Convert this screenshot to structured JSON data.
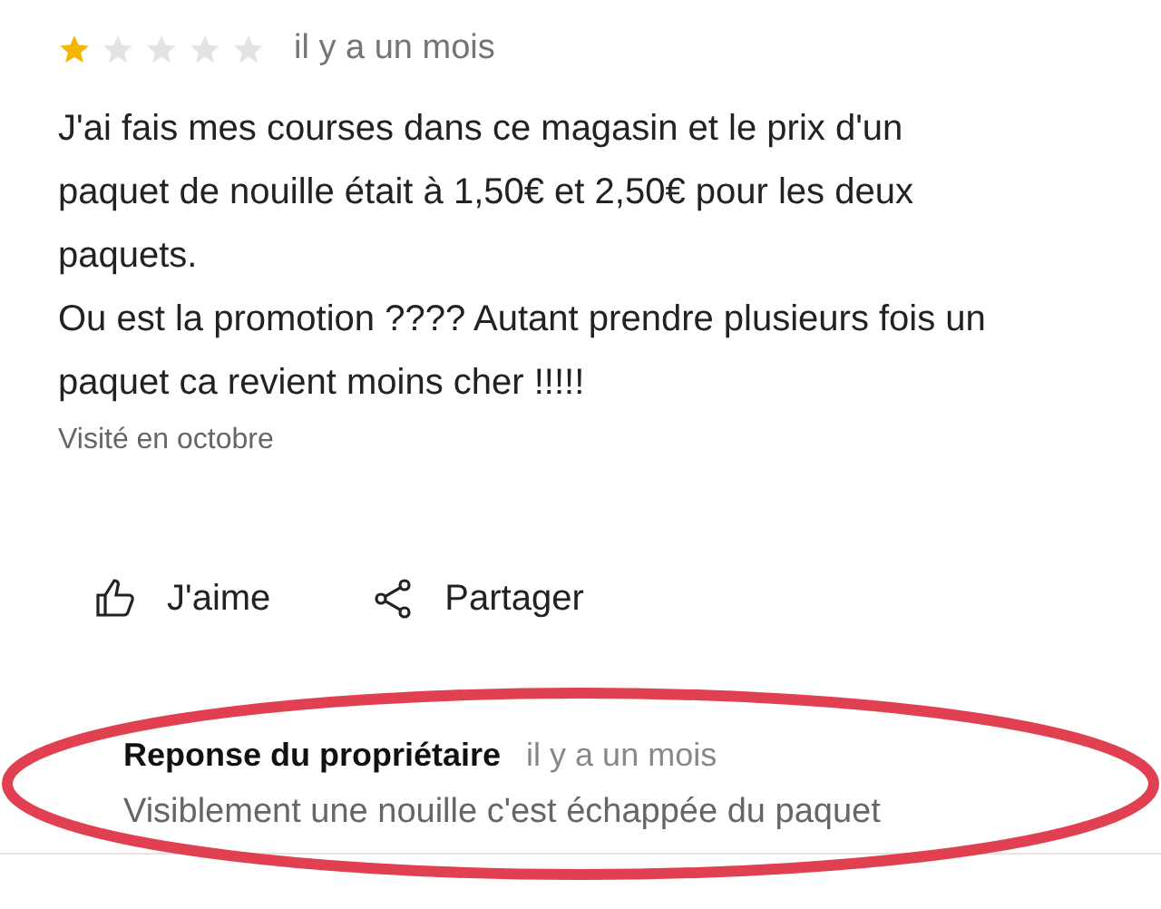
{
  "review": {
    "stars": 1,
    "time": "il y a un mois",
    "paragraphs": [
      "J'ai fais mes courses dans ce magasin et le prix d'un paquet de nouille était à 1,50€ et 2,50€ pour les deux paquets.",
      "Ou est la promotion ???? Autant prendre plusieurs fois un paquet ca revient moins cher !!!!!"
    ],
    "visited": "Visité en octobre"
  },
  "actions": [
    {
      "kind": "like",
      "label": "J'aime"
    },
    {
      "kind": "share",
      "label": "Partager"
    }
  ],
  "owner_reply": {
    "title": "Reponse du propriétaire",
    "time": "il y a un mois",
    "text": "Visiblement une nouille c'est échappée du paquet"
  }
}
